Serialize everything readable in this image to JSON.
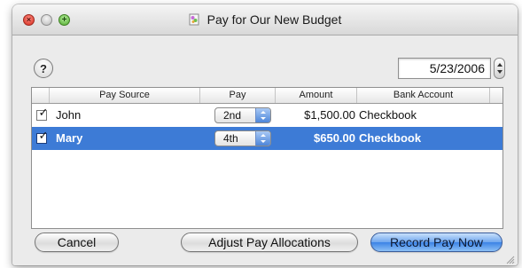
{
  "window": {
    "title": "Pay for Our New Budget"
  },
  "toolbar": {
    "help_label": "?",
    "date_value": "5/23/2006"
  },
  "table": {
    "columns": [
      "Pay Source",
      "Pay",
      "Amount",
      "Bank Account"
    ],
    "rows": [
      {
        "checked": true,
        "check_mark": "✓",
        "source": "John",
        "pay": "2nd",
        "amount": "$1,500.00",
        "bank": "Checkbook",
        "selected": false
      },
      {
        "checked": true,
        "check_mark": "✓",
        "source": "Mary",
        "pay": "4th",
        "amount": "$650.00",
        "bank": "Checkbook",
        "selected": true
      }
    ]
  },
  "buttons": {
    "cancel": "Cancel",
    "adjust": "Adjust Pay Allocations",
    "record": "Record Pay Now"
  },
  "colors": {
    "selection": "#3d7bd6",
    "default_button": "#3c83e6",
    "close": "#d3281a",
    "zoom": "#4fa82c"
  },
  "icons": {
    "close": "close-icon",
    "minimize": "minimize-icon",
    "zoom": "zoom-icon",
    "document": "document-icon",
    "stepper": "stepper-icon",
    "popup_arrows": "popup-arrows-icon",
    "resize": "resize-grip-icon"
  }
}
